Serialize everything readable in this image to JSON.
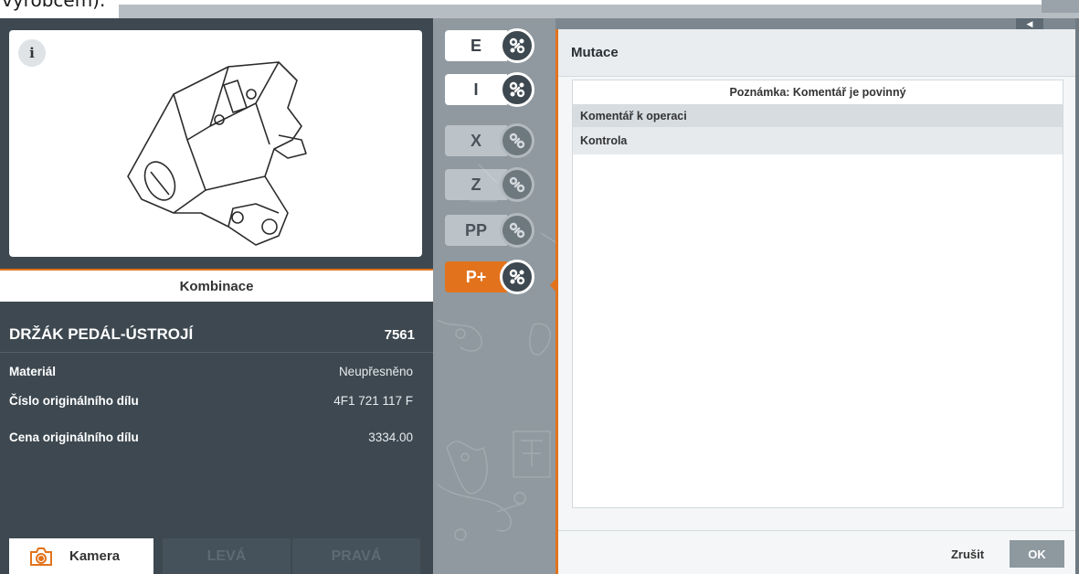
{
  "top": {
    "cut_text": "výrobcem)."
  },
  "left_panel": {
    "info_label": "i",
    "combination_label": "Kombinace",
    "part": {
      "name": "DRŽÁK PEDÁL-ÚSTROJÍ",
      "number": "7561",
      "properties": [
        {
          "label": "Materiál",
          "value": "Neupřesněno"
        },
        {
          "label": "Číslo originálního dílu",
          "value": "4F1 721 117 F"
        },
        {
          "label": "Cena originálního dílu",
          "value": "3334.00"
        }
      ]
    },
    "buttons": {
      "camera": "Kamera",
      "left": "LEVÁ",
      "right": "PRAVÁ"
    }
  },
  "categories": [
    {
      "letter": "E",
      "state": "active"
    },
    {
      "letter": "I",
      "state": "active"
    },
    {
      "letter": "X",
      "state": "inactive"
    },
    {
      "letter": "Z",
      "state": "inactive"
    },
    {
      "letter": "PP",
      "state": "inactive"
    },
    {
      "letter": "P+",
      "state": "selected"
    }
  ],
  "dialog": {
    "title": "Mutace",
    "note": "Poznámka: Komentář je povinný",
    "options": [
      "Komentář k operaci",
      "Kontrola"
    ],
    "cancel": "Zrušit",
    "ok": "OK"
  },
  "colors": {
    "accent": "#e2731c",
    "panel": "#3d4850",
    "mid_strip": "#8f999f"
  },
  "icons": {
    "info": "info-icon",
    "camera": "camera-icon",
    "category": "link-chain-icon"
  }
}
